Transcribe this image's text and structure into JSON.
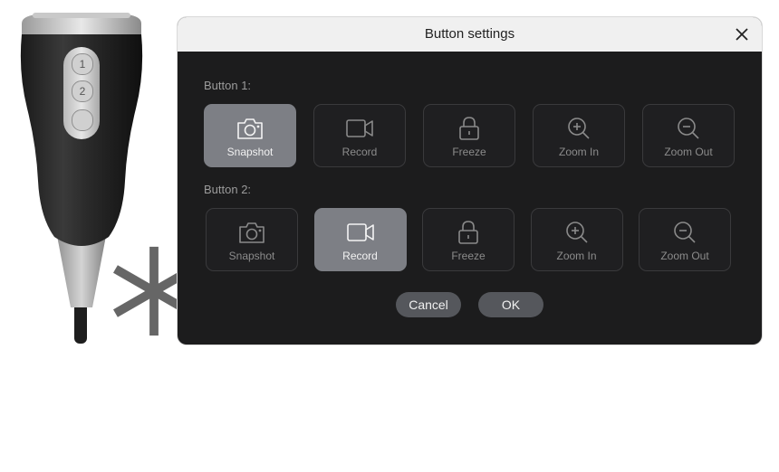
{
  "dialog": {
    "title": "Button settings",
    "cancel_label": "Cancel",
    "ok_label": "OK"
  },
  "device": {
    "buttons": [
      "1",
      "2"
    ]
  },
  "button1": {
    "label": "Button 1:",
    "options": [
      {
        "label": "Snapshot",
        "icon": "camera-icon",
        "selected": true
      },
      {
        "label": "Record",
        "icon": "video-icon",
        "selected": false
      },
      {
        "label": "Freeze",
        "icon": "lock-icon",
        "selected": false
      },
      {
        "label": "Zoom In",
        "icon": "zoom-in-icon",
        "selected": false
      },
      {
        "label": "Zoom Out",
        "icon": "zoom-out-icon",
        "selected": false
      }
    ]
  },
  "button2": {
    "label": "Button 2:",
    "options": [
      {
        "label": "Snapshot",
        "icon": "camera-icon",
        "selected": false
      },
      {
        "label": "Record",
        "icon": "video-icon",
        "selected": true
      },
      {
        "label": "Freeze",
        "icon": "lock-icon",
        "selected": false
      },
      {
        "label": "Zoom In",
        "icon": "zoom-in-icon",
        "selected": false
      },
      {
        "label": "Zoom Out",
        "icon": "zoom-out-icon",
        "selected": false
      }
    ]
  },
  "colors": {
    "dialog_bg": "#1c1c1d",
    "titlebar_bg": "#f0f0f0",
    "selected_bg": "#7d7f85",
    "option_border": "#3a3a3c",
    "button_bg": "#55575c"
  }
}
